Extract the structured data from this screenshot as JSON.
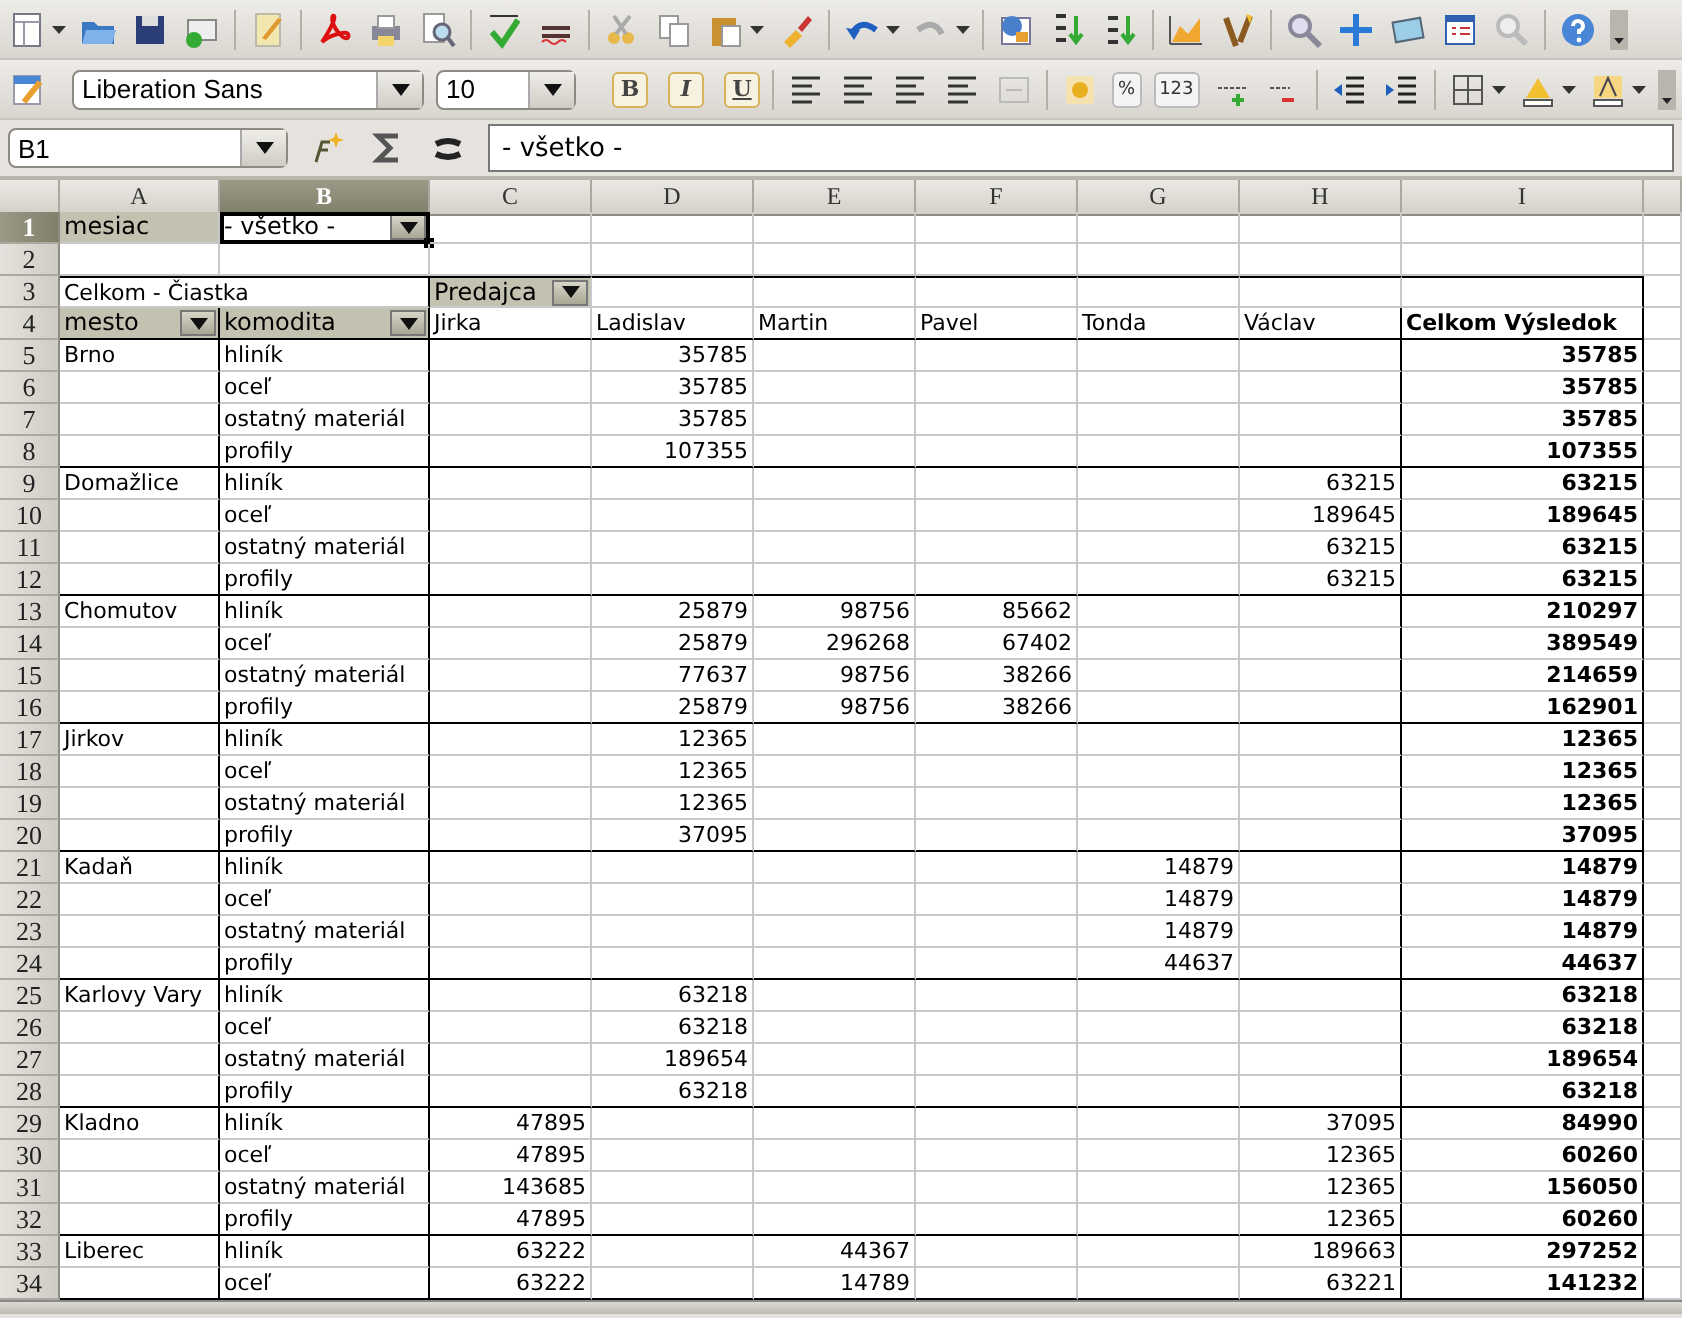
{
  "formatting_toolbar": {
    "font_name": "Liberation Sans",
    "font_size": "10",
    "style_buttons": [
      "B",
      "I",
      "U"
    ],
    "number_buttons": [
      "%",
      "123"
    ]
  },
  "formula_bar": {
    "cell_reference": "B1",
    "value": "- všetko -"
  },
  "column_headers": [
    {
      "label": "A",
      "selected": false
    },
    {
      "label": "B",
      "selected": true
    },
    {
      "label": "C",
      "selected": false
    },
    {
      "label": "D",
      "selected": false
    },
    {
      "label": "E",
      "selected": false
    },
    {
      "label": "F",
      "selected": false
    },
    {
      "label": "G",
      "selected": false
    },
    {
      "label": "H",
      "selected": false
    },
    {
      "label": "I",
      "selected": false
    }
  ],
  "row_headers": [
    {
      "label": "1",
      "selected": true
    },
    {
      "label": "2",
      "selected": false
    },
    {
      "label": "3",
      "selected": false
    },
    {
      "label": "4",
      "selected": false
    },
    {
      "label": "5",
      "selected": false
    },
    {
      "label": "6",
      "selected": false
    },
    {
      "label": "7",
      "selected": false
    },
    {
      "label": "8",
      "selected": false
    },
    {
      "label": "9",
      "selected": false
    },
    {
      "label": "10",
      "selected": false
    },
    {
      "label": "11",
      "selected": false
    },
    {
      "label": "12",
      "selected": false
    },
    {
      "label": "13",
      "selected": false
    },
    {
      "label": "14",
      "selected": false
    },
    {
      "label": "15",
      "selected": false
    },
    {
      "label": "16",
      "selected": false
    },
    {
      "label": "17",
      "selected": false
    },
    {
      "label": "18",
      "selected": false
    },
    {
      "label": "19",
      "selected": false
    },
    {
      "label": "20",
      "selected": false
    },
    {
      "label": "21",
      "selected": false
    },
    {
      "label": "22",
      "selected": false
    },
    {
      "label": "23",
      "selected": false
    },
    {
      "label": "24",
      "selected": false
    },
    {
      "label": "25",
      "selected": false
    },
    {
      "label": "26",
      "selected": false
    },
    {
      "label": "27",
      "selected": false
    },
    {
      "label": "28",
      "selected": false
    },
    {
      "label": "29",
      "selected": false
    },
    {
      "label": "30",
      "selected": false
    },
    {
      "label": "31",
      "selected": false
    },
    {
      "label": "32",
      "selected": false
    },
    {
      "label": "33",
      "selected": false
    },
    {
      "label": "34",
      "selected": false
    }
  ],
  "pivot_table": {
    "page_field": {
      "name": "mesiac",
      "value": "- všetko -"
    },
    "data_field": "Celkom - Čiastka",
    "column_field": "Predajca",
    "row_fields": [
      "mesto",
      "komodita"
    ],
    "column_items": [
      "Jirka",
      "Ladislav",
      "Martin",
      "Pavel",
      "Tonda",
      "Václav"
    ],
    "total_header": "Celkom Výsledok",
    "groups": [
      {
        "city": "Brno",
        "rows": [
          {
            "item": "hliník",
            "values": {
              "column_d": "35785"
            },
            "total": "35785"
          },
          {
            "item": "oceľ",
            "values": {
              "column_d": "35785"
            },
            "total": "35785"
          },
          {
            "item": "ostatný materiál",
            "values": {
              "column_d": "35785"
            },
            "total": "35785"
          },
          {
            "item": "profily",
            "values": {
              "column_d": "107355"
            },
            "total": "107355"
          }
        ]
      },
      {
        "city": "Domažlice",
        "rows": [
          {
            "item": "hliník",
            "values": {
              "column_h": "63215"
            },
            "total": "63215"
          },
          {
            "item": "oceľ",
            "values": {
              "column_h": "189645"
            },
            "total": "189645"
          },
          {
            "item": "ostatný materiál",
            "values": {
              "column_h": "63215"
            },
            "total": "63215"
          },
          {
            "item": "profily",
            "values": {
              "column_h": "63215"
            },
            "total": "63215"
          }
        ]
      },
      {
        "city": "Chomutov",
        "rows": [
          {
            "item": "hliník",
            "values": {
              "column_d": "25879",
              "column_e": "98756",
              "column_f": "85662"
            },
            "total": "210297"
          },
          {
            "item": "oceľ",
            "values": {
              "column_d": "25879",
              "column_e": "296268",
              "column_f": "67402"
            },
            "total": "389549"
          },
          {
            "item": "ostatný materiál",
            "values": {
              "column_d": "77637",
              "column_e": "98756",
              "column_f": "38266"
            },
            "total": "214659"
          },
          {
            "item": "profily",
            "values": {
              "column_d": "25879",
              "column_e": "98756",
              "column_f": "38266"
            },
            "total": "162901"
          }
        ]
      },
      {
        "city": "Jirkov",
        "rows": [
          {
            "item": "hliník",
            "values": {
              "column_d": "12365"
            },
            "total": "12365"
          },
          {
            "item": "oceľ",
            "values": {
              "column_d": "12365"
            },
            "total": "12365"
          },
          {
            "item": "ostatný materiál",
            "values": {
              "column_d": "12365"
            },
            "total": "12365"
          },
          {
            "item": "profily",
            "values": {
              "column_d": "37095"
            },
            "total": "37095"
          }
        ]
      },
      {
        "city": "Kadaň",
        "rows": [
          {
            "item": "hliník",
            "values": {
              "column_g": "14879"
            },
            "total": "14879"
          },
          {
            "item": "oceľ",
            "values": {
              "column_g": "14879"
            },
            "total": "14879"
          },
          {
            "item": "ostatný materiál",
            "values": {
              "column_g": "14879"
            },
            "total": "14879"
          },
          {
            "item": "profily",
            "values": {
              "column_g": "44637"
            },
            "total": "44637"
          }
        ]
      },
      {
        "city": "Karlovy Vary",
        "rows": [
          {
            "item": "hliník",
            "values": {
              "column_d": "63218"
            },
            "total": "63218"
          },
          {
            "item": "oceľ",
            "values": {
              "column_d": "63218"
            },
            "total": "63218"
          },
          {
            "item": "ostatný materiál",
            "values": {
              "column_d": "189654"
            },
            "total": "189654"
          },
          {
            "item": "profily",
            "values": {
              "column_d": "63218"
            },
            "total": "63218"
          }
        ]
      },
      {
        "city": "Kladno",
        "rows": [
          {
            "item": "hliník",
            "values": {
              "column_c": "47895",
              "column_h": "37095"
            },
            "total": "84990"
          },
          {
            "item": "oceľ",
            "values": {
              "column_c": "47895",
              "column_h": "12365"
            },
            "total": "60260"
          },
          {
            "item": "ostatný materiál",
            "values": {
              "column_c": "143685",
              "column_h": "12365"
            },
            "total": "156050"
          },
          {
            "item": "profily",
            "values": {
              "column_c": "47895",
              "column_h": "12365"
            },
            "total": "60260"
          }
        ]
      },
      {
        "city": "Liberec",
        "rows": [
          {
            "item": "hliník",
            "values": {
              "column_c": "63222",
              "column_e": "44367",
              "column_h": "189663"
            },
            "total": "297252"
          },
          {
            "item": "oceľ",
            "values": {
              "column_c": "63222",
              "column_e": "14789",
              "column_h": "63221"
            },
            "total": "141232"
          }
        ]
      }
    ]
  }
}
